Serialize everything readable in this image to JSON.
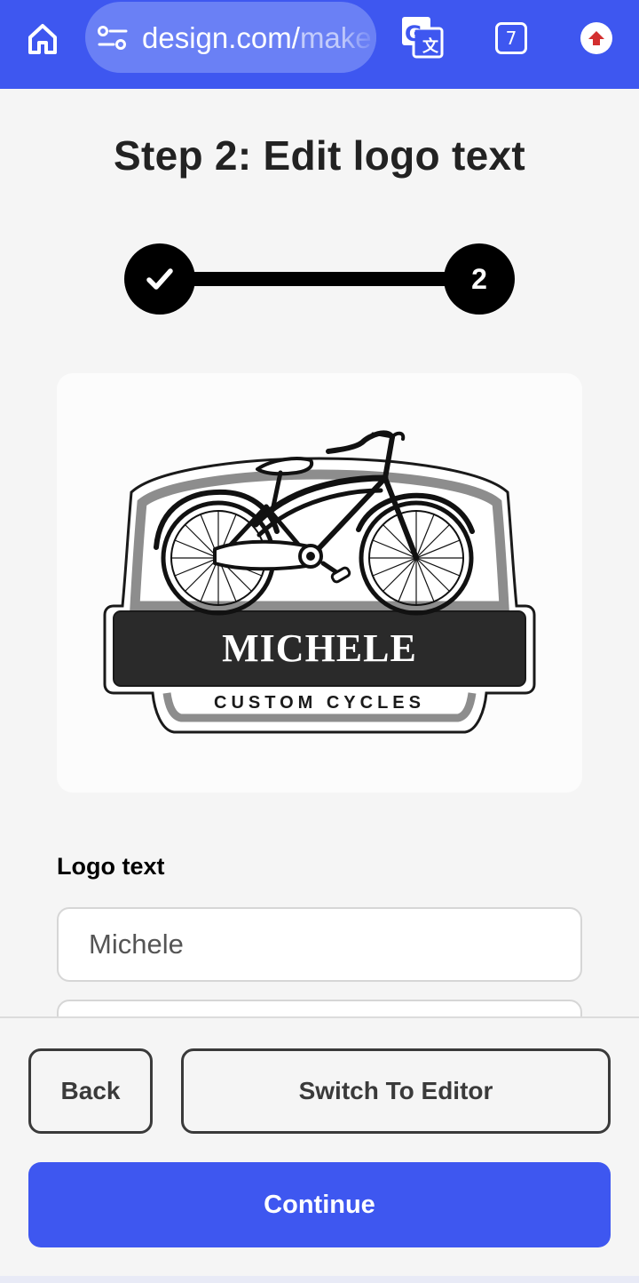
{
  "browser": {
    "url_visible": "design.com/",
    "url_faded": "make",
    "tab_count": "7",
    "accent_color": "#3e57f0"
  },
  "page": {
    "title": "Step 2: Edit logo text",
    "stepper": {
      "steps": [
        {
          "state": "completed",
          "icon": "check-icon"
        },
        {
          "state": "current",
          "label": "2"
        }
      ]
    },
    "logo_preview": {
      "name_text": "MICHELE",
      "tagline_text": "CUSTOM CYCLES",
      "icon": "bicycle-icon"
    },
    "form": {
      "logo_text_label": "Logo text",
      "logo_text_value": "Michele"
    }
  },
  "actions": {
    "back_label": "Back",
    "switch_editor_label": "Switch To Editor",
    "continue_label": "Continue"
  }
}
